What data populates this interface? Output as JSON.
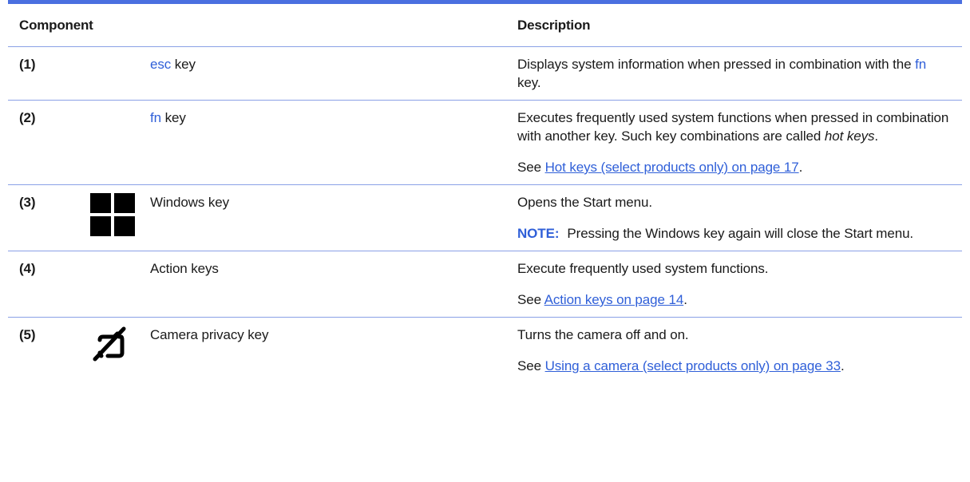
{
  "header": {
    "component": "Component",
    "description": "Description"
  },
  "rows": [
    {
      "number": "(1)",
      "name_key": "esc",
      "name_suffix": " key",
      "desc_p1_a": "Displays system information when pressed in combination with the ",
      "desc_p1_key": "fn",
      "desc_p1_b": " key."
    },
    {
      "number": "(2)",
      "name_key": "fn",
      "name_suffix": " key",
      "desc_p1_a": "Executes frequently used system functions when pressed in combination with another key. Such key combinations are called ",
      "desc_p1_em": "hot keys",
      "desc_p1_b": ".",
      "see_prefix": "See ",
      "see_link": "Hot keys (select products only) on page 17",
      "see_suffix": "."
    },
    {
      "number": "(3)",
      "icon": "windows-logo-icon",
      "name": "Windows key",
      "desc_p1": "Opens the Start menu.",
      "note_label": "NOTE:",
      "note_text": "Pressing the Windows key again will close the Start menu."
    },
    {
      "number": "(4)",
      "name": "Action keys",
      "desc_p1": "Execute frequently used system functions.",
      "see_prefix": "See ",
      "see_link": "Action keys on page 14",
      "see_suffix": "."
    },
    {
      "number": "(5)",
      "icon": "camera-privacy-icon",
      "name": "Camera privacy key",
      "desc_p1": "Turns the camera off and on.",
      "see_prefix": "See ",
      "see_link": "Using a camera (select products only) on page 33",
      "see_suffix": "."
    }
  ],
  "colors": {
    "accent": "#4a6fe0",
    "link": "#2f5fd8",
    "rule": "#8aa0e6"
  }
}
